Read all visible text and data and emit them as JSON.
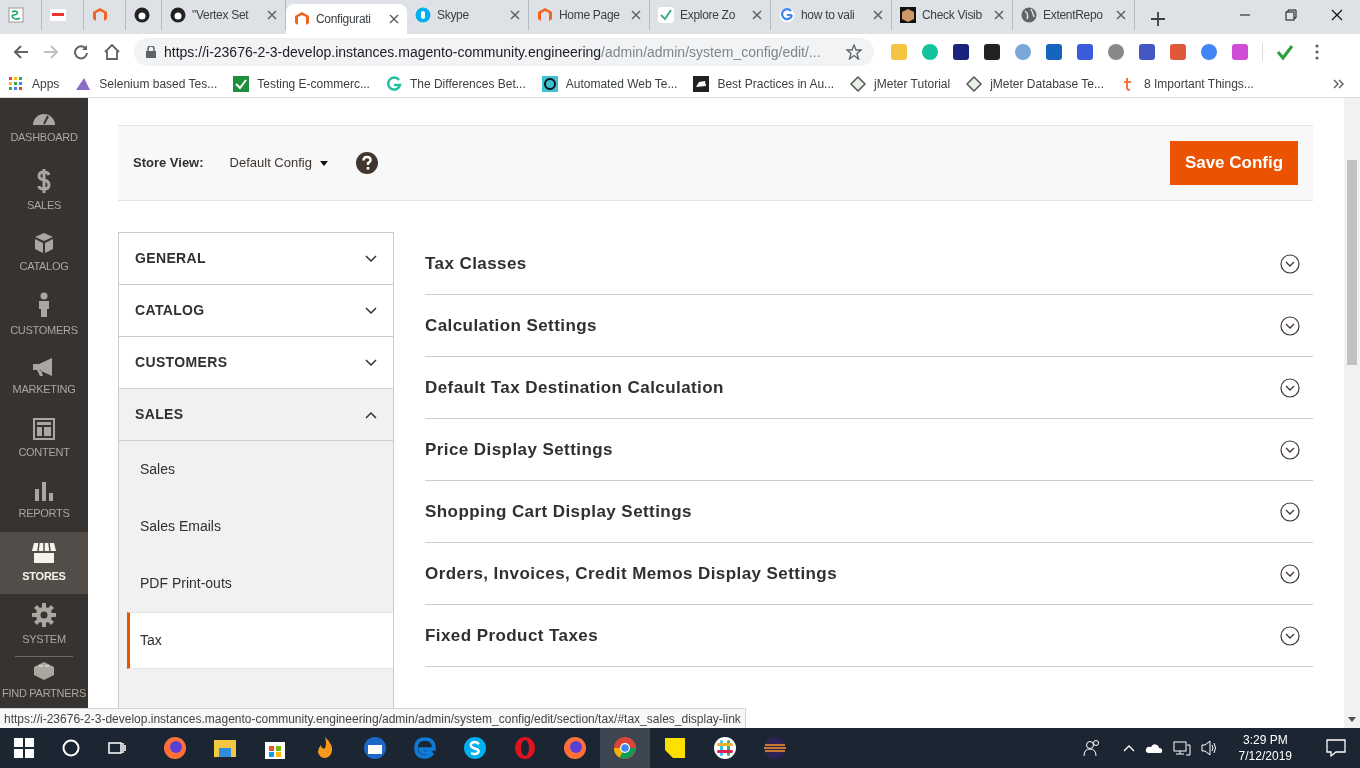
{
  "browser": {
    "tabs": [
      {
        "selected": false
      },
      {
        "selected": false
      },
      {
        "selected": false
      },
      {
        "selected": false
      },
      {
        "title": "\"Vertex Set",
        "selected": false
      },
      {
        "title": "Configurati",
        "selected": true
      },
      {
        "title": "Skype",
        "selected": false
      },
      {
        "title": "Home Page",
        "selected": false
      },
      {
        "title": "Explore Zo",
        "selected": false
      },
      {
        "title": "how to vali",
        "selected": false
      },
      {
        "title": "Check Visib",
        "selected": false
      },
      {
        "title": "ExtentRepo",
        "selected": false
      }
    ],
    "url": {
      "host": "https://i-23676-2-3-develop.instances.magento-community.engineering",
      "path": "/admin/admin/system_config/edit/..."
    },
    "bookmarks": [
      "Apps",
      "Selenium based Tes...",
      "Testing E-commerc...",
      "The Differences Bet...",
      "Automated Web Te...",
      "Best Practices in Au...",
      "jMeter Tutorial",
      "jMeter Database Te...",
      "8 Important Things..."
    ],
    "status_url": "https://i-23676-2-3-develop.instances.magento-community.engineering/admin/admin/system_config/edit/section/tax/#tax_sales_display-link"
  },
  "admin_menu": [
    {
      "label": "DASHBOARD",
      "selected": false
    },
    {
      "label": "SALES",
      "selected": false
    },
    {
      "label": "CATALOG",
      "selected": false
    },
    {
      "label": "CUSTOMERS",
      "selected": false
    },
    {
      "label": "MARKETING",
      "selected": false
    },
    {
      "label": "CONTENT",
      "selected": false
    },
    {
      "label": "REPORTS",
      "selected": false
    },
    {
      "label": "STORES",
      "selected": true
    },
    {
      "label": "SYSTEM",
      "selected": false
    },
    {
      "label": "FIND PARTNERS",
      "selected": false
    }
  ],
  "store_view": {
    "label": "Store View:",
    "value": "Default Config",
    "button": "Save Config"
  },
  "config_nav": [
    {
      "label": "GENERAL",
      "expanded": false
    },
    {
      "label": "CATALOG",
      "expanded": false
    },
    {
      "label": "CUSTOMERS",
      "expanded": false
    },
    {
      "label": "SALES",
      "expanded": true,
      "children": [
        {
          "label": "Sales",
          "selected": false
        },
        {
          "label": "Sales Emails",
          "selected": false
        },
        {
          "label": "PDF Print-outs",
          "selected": false
        },
        {
          "label": "Tax",
          "selected": true
        }
      ]
    }
  ],
  "sections": [
    {
      "title": "Tax Classes",
      "expanded": false
    },
    {
      "title": "Calculation Settings",
      "expanded": false
    },
    {
      "title": "Default Tax Destination Calculation",
      "expanded": false
    },
    {
      "title": "Price Display Settings",
      "expanded": false
    },
    {
      "title": "Shopping Cart Display Settings",
      "expanded": false
    },
    {
      "title": "Orders, Invoices, Credit Memos Display Settings",
      "expanded": false
    },
    {
      "title": "Fixed Product Taxes",
      "expanded": false
    }
  ],
  "taskbar": {
    "time": "3:29 PM",
    "date": "7/12/2019"
  }
}
